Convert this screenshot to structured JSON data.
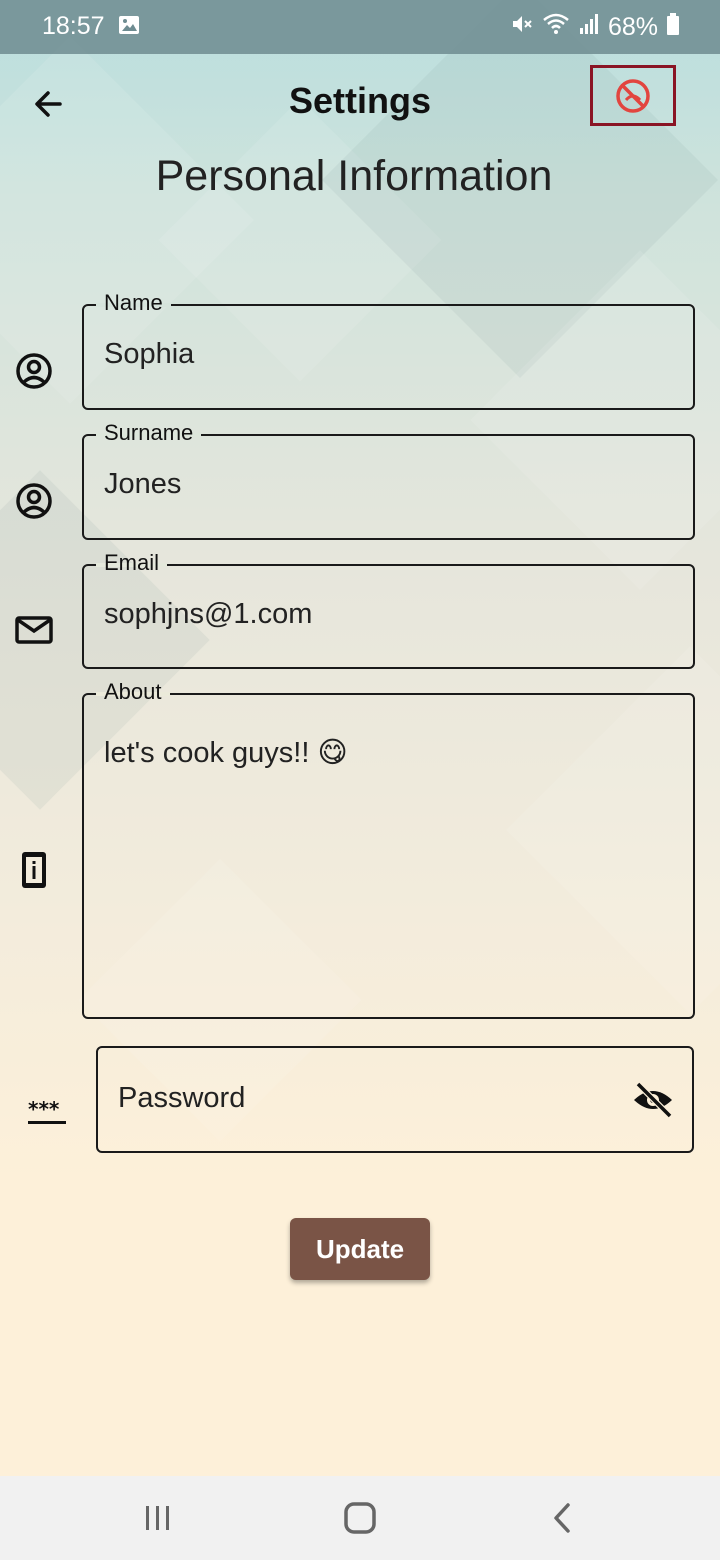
{
  "status": {
    "time": "18:57",
    "battery": "68%"
  },
  "appbar": {
    "title": "Settings"
  },
  "page": {
    "subtitle": "Personal Information"
  },
  "form": {
    "name": {
      "label": "Name",
      "value": "Sophia"
    },
    "surname": {
      "label": "Surname",
      "value": "Jones"
    },
    "email": {
      "label": "Email",
      "value": "sophjns@1.com"
    },
    "about": {
      "label": "About",
      "value": "let's cook guys!! 😋"
    },
    "password": {
      "placeholder": "Password"
    }
  },
  "actions": {
    "update_label": "Update"
  },
  "icons": {
    "back": "arrow-back-icon",
    "action": "no-entry-icon",
    "name": "account-circle-icon",
    "surname": "account-circle-icon",
    "email": "mail-icon",
    "about": "info-device-icon",
    "password": "password-icon",
    "visibility": "visibility-off-icon"
  },
  "colors": {
    "accent_button": "#7a5446",
    "highlight_border": "#8a1424",
    "no_entry_icon": "#e2453f"
  }
}
